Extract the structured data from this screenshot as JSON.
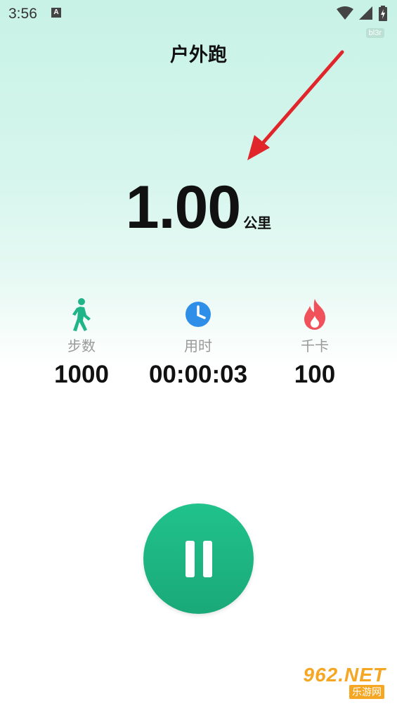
{
  "status_bar": {
    "time": "3:56",
    "notification_badge": "A"
  },
  "watermark_top": "bl3r",
  "title": "户外跑",
  "distance": {
    "value": "1.00",
    "unit": "公里"
  },
  "stats": [
    {
      "icon": "walking-person-icon",
      "label": "步数",
      "value": "1000",
      "color": "#1fb589"
    },
    {
      "icon": "clock-icon",
      "label": "用时",
      "value": "00:00:03",
      "color": "#2f8fe8"
    },
    {
      "icon": "flame-icon",
      "label": "千卡",
      "value": "100",
      "color": "#f0515a"
    }
  ],
  "pause_button": {
    "icon": "pause-icon"
  },
  "logo": {
    "main": "962.NET",
    "sub": "乐游网"
  },
  "colors": {
    "accent": "#1fb589",
    "arrow": "#e0262b"
  }
}
